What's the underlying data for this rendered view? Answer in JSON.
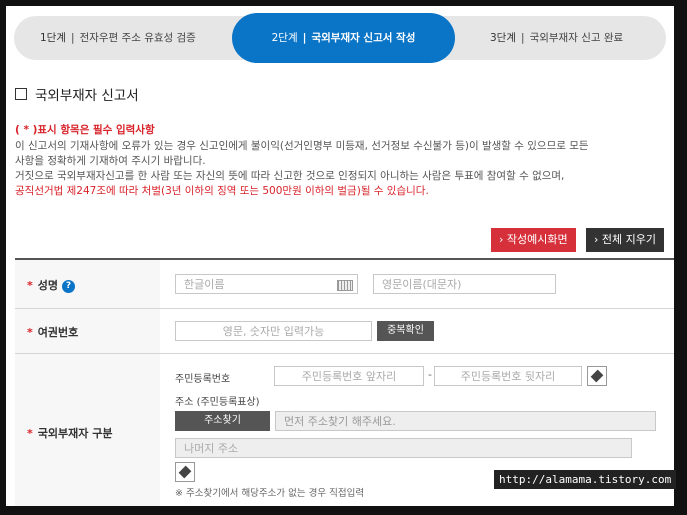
{
  "steps": [
    {
      "num": "1단계",
      "label": "전자우편 주소 유효성 검증"
    },
    {
      "num": "2단계",
      "label": "국외부재자 신고서 작성"
    },
    {
      "num": "3단계",
      "label": "국외부재자 신고 완료"
    }
  ],
  "step_separator": "|",
  "form_title": "국외부재자 신고서",
  "required_note": "( * )표시 항목은 필수 입력사항",
  "desc_line1": "이 신고서의 기재사항에 오류가 있는 경우 신고인에게 불이익(선거인명부 미등재, 선거정보 수신불가 등)이 발생할 수 있으므로 모든",
  "desc_line2": "사항을 정확하게 기재하여 주시기 바랍니다.",
  "desc_line3": "거짓으로 국외부재자신고를 한 사람 또는 자신의 뜻에 따라 신고한 것으로 인정되지 아니하는 사람은 투표에 참여할 수 없으며,",
  "desc_line4": "공직선거법 제247조에 따라 처벌(3년 이하의 징역 또는 500만원 이하의 벌금)될 수 있습니다.",
  "buttons": {
    "example": "› 작성예시화면",
    "clear": "› 전체 지우기"
  },
  "fields": {
    "name": {
      "label": "성명",
      "help": "?",
      "korean_placeholder": "한글이름",
      "english_placeholder": "영문이름(대문자)"
    },
    "passport": {
      "label": "여권번호",
      "placeholder": "영문, 숫자만 입력가능",
      "check_button": "중복확인"
    },
    "absentee": {
      "label": "국외부재자 구분",
      "rrn_label": "주민등록번호",
      "rrn_front_placeholder": "주민등록번호 앞자리",
      "rrn_dash": "-",
      "rrn_back_placeholder": "주민등록번호 뒷자리",
      "address_label": "주소 (주민등록표상)",
      "address_search_button": "주소찾기",
      "address_placeholder": "먼저 주소찾기 해주세요.",
      "address_rest_placeholder": "나머지 주소",
      "address_note": "※ 주소찾기에서 해당주소가 없는 경우 직접입력"
    }
  },
  "required_mark": "*",
  "watermark": "http://alamama.tistory.com"
}
